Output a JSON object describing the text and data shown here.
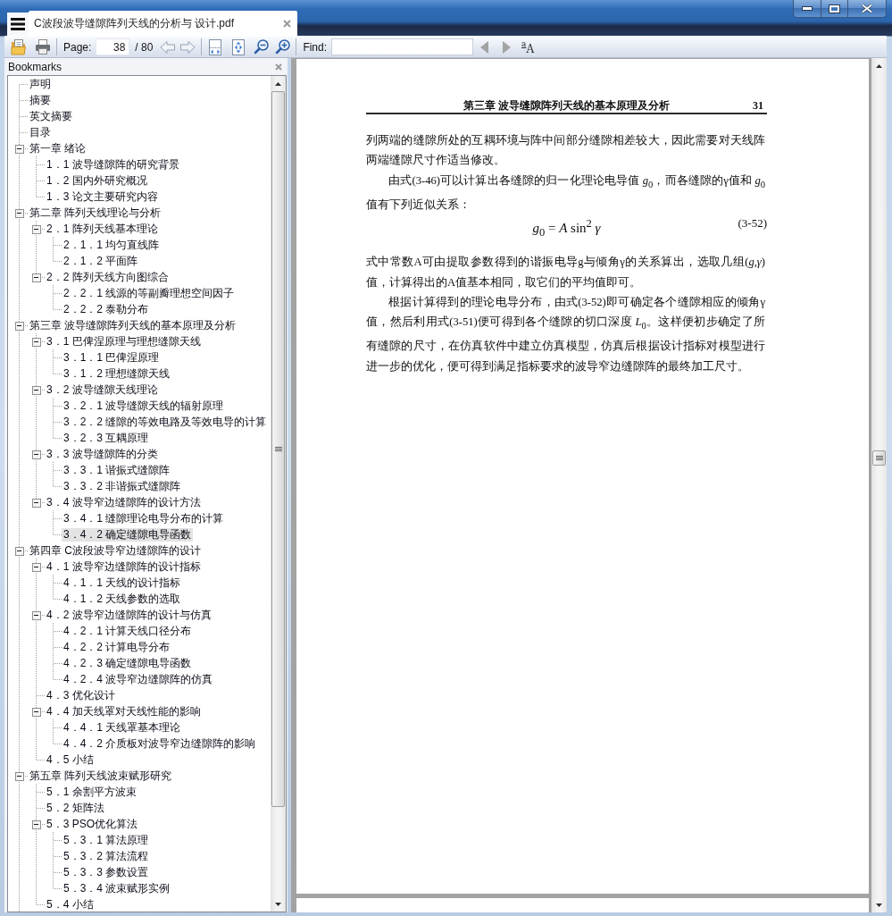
{
  "tab": {
    "title": "C波段波导缝隙阵列天线的分析与 设计.pdf"
  },
  "toolbar": {
    "page_label": "Page:",
    "page_value": "38",
    "page_total": "/ 80",
    "find_label": "Find:",
    "find_previous": {
      "disabled": true
    },
    "find_next": {
      "disabled": true
    },
    "match_case": {
      "small": "a",
      "large": "A"
    }
  },
  "bookmarks": {
    "title": "Bookmarks",
    "more_below": true,
    "items": [
      {
        "label": "声明",
        "selected": false
      },
      {
        "label": "摘要",
        "selected": false
      },
      {
        "label": "英文摘要",
        "selected": false
      },
      {
        "label": "目录",
        "selected": false
      },
      {
        "label": "第一章 绪论",
        "selected": false,
        "expanded": true,
        "children": [
          {
            "label": "1．1 波导缝隙阵的研究背景",
            "selected": false
          },
          {
            "label": "1．2 国内外研究概况",
            "selected": false
          },
          {
            "label": "1．3 论文主要研究内容",
            "selected": false
          }
        ]
      },
      {
        "label": "第二章 阵列天线理论与分析",
        "selected": false,
        "expanded": true,
        "children": [
          {
            "label": "2．1 阵列天线基本理论",
            "selected": false,
            "expanded": true,
            "children": [
              {
                "label": "2．1．1 均匀直线阵",
                "selected": false
              },
              {
                "label": "2．1．2 平面阵",
                "selected": false
              }
            ]
          },
          {
            "label": "2．2 阵列天线方向图综合",
            "selected": false,
            "expanded": true,
            "children": [
              {
                "label": "2．2．1 线源的等副瓣理想空间因子",
                "selected": false
              },
              {
                "label": "2．2．2 泰勒分布",
                "selected": false
              }
            ]
          }
        ]
      },
      {
        "label": "第三章 波导缝隙阵列天线的基本原理及分析",
        "selected": false,
        "expanded": true,
        "children": [
          {
            "label": "3．1 巴俾涅原理与理想缝隙天线",
            "selected": false,
            "expanded": true,
            "children": [
              {
                "label": "3．1．1 巴俾涅原理",
                "selected": false
              },
              {
                "label": "3．1．2 理想缝隙天线",
                "selected": false
              }
            ]
          },
          {
            "label": "3．2 波导缝隙天线理论",
            "selected": false,
            "expanded": true,
            "children": [
              {
                "label": "3．2．1 波导缝隙天线的辐射原理",
                "selected": false
              },
              {
                "label": "3．2．2 缝隙的等效电路及等效电导的计算",
                "selected": false
              },
              {
                "label": "3．2．3 互耦原理",
                "selected": false
              }
            ]
          },
          {
            "label": "3．3 波导缝隙阵的分类",
            "selected": false,
            "expanded": true,
            "children": [
              {
                "label": "3．3．1 谐振式缝隙阵",
                "selected": false
              },
              {
                "label": "3．3．2 非谐振式缝隙阵",
                "selected": false
              }
            ]
          },
          {
            "label": "3．4 波导窄边缝隙阵的设计方法",
            "selected": false,
            "expanded": true,
            "children": [
              {
                "label": "3．4．1 缝隙理论电导分布的计算",
                "selected": false
              },
              {
                "label": "3．4．2 确定缝隙电导函数",
                "selected": true
              }
            ]
          }
        ]
      },
      {
        "label": "第四章 C波段波导窄边缝隙阵的设计",
        "selected": false,
        "expanded": true,
        "children": [
          {
            "label": "4．1 波导窄边缝隙阵的设计指标",
            "selected": false,
            "expanded": true,
            "children": [
              {
                "label": "4．1．1 天线的设计指标",
                "selected": false
              },
              {
                "label": "4．1．2 天线参数的选取",
                "selected": false
              }
            ]
          },
          {
            "label": "4．2 波导窄边缝隙阵的设计与仿真",
            "selected": false,
            "expanded": true,
            "children": [
              {
                "label": "4．2．1 计算天线口径分布",
                "selected": false
              },
              {
                "label": "4．2．2 计算电导分布",
                "selected": false
              },
              {
                "label": "4．2．3 确定缝隙电导函数",
                "selected": false
              },
              {
                "label": "4．2．4 波导窄边缝隙阵的仿真",
                "selected": false
              }
            ]
          },
          {
            "label": "4．3 优化设计",
            "selected": false
          },
          {
            "label": "4．4 加天线罩对天线性能的影响",
            "selected": false,
            "expanded": true,
            "children": [
              {
                "label": "4．4．1 天线罩基本理论",
                "selected": false
              },
              {
                "label": "4．4．2 介质板对波导窄边缝隙阵的影响",
                "selected": false
              }
            ]
          },
          {
            "label": "4．5 小结",
            "selected": false
          }
        ]
      },
      {
        "label": "第五章 阵列天线波束赋形研究",
        "selected": false,
        "expanded": true,
        "children": [
          {
            "label": "5．1 余割平方波束",
            "selected": false
          },
          {
            "label": "5．2 矩阵法",
            "selected": false
          },
          {
            "label": "5．3 PSO优化算法",
            "selected": false,
            "expanded": true,
            "children": [
              {
                "label": "5．3．1 算法原理",
                "selected": false
              },
              {
                "label": "5．3．2 算法流程",
                "selected": false
              },
              {
                "label": "5．3．3 参数设置",
                "selected": false
              },
              {
                "label": "5．3．4 波束赋形实例",
                "selected": false
              }
            ]
          },
          {
            "label": "5．4 小结",
            "selected": false
          }
        ]
      }
    ]
  },
  "document": {
    "running_head": "第三章 波导缝隙阵列天线的基本原理及分析",
    "page_number": "31",
    "blocks": [
      {
        "kind": "paragraph",
        "continues_previous": true,
        "text": "列两端的缝隙所处的互耦环境与阵中间部分缝隙相差较大，因此需要对天线阵两端缝隙尺寸作适当修改。"
      },
      {
        "kind": "paragraph",
        "continues_previous": false,
        "text": "由式(3-46)可以计算出各缝隙的归一化理论电导值 *g*$_{0}$，而各缝隙的γ值和 *g*$_{0}$ 值有下列近似关系："
      },
      {
        "kind": "equation",
        "text": "*g*$_{0}$ = *A* sin$^{2}$ *γ*",
        "number": "(3-52)"
      },
      {
        "kind": "paragraph",
        "continues_previous": true,
        "text": "式中常数A可由提取参数得到的谐振电导g与倾角γ的关系算出，选取几组(*g*,*γ*)值，计算得出的A值基本相同，取它们的平均值即可。"
      },
      {
        "kind": "paragraph",
        "continues_previous": false,
        "text": "根据计算得到的理论电导分布，由式(3-52)即可确定各个缝隙相应的倾角γ值，然后利用式(3-51)便可得到各个缝隙的切口深度 *L*$_{0}$。这样便初步确定了所有缝隙的尺寸，在仿真软件中建立仿真模型，仿真后根据设计指标对模型进行进一步的优化，便可得到满足指标要求的波导窄边缝隙阵的最终加工尺寸。"
      }
    ]
  }
}
